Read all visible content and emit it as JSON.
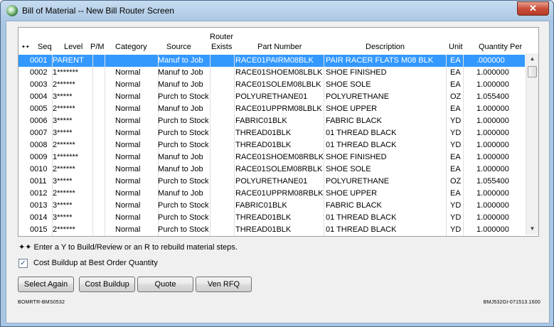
{
  "window": {
    "title": "Bill of Material -- New Bill Router Screen",
    "close_label": "✕"
  },
  "grid": {
    "headers": {
      "marker": "✦✦",
      "seq": "Seq",
      "level": "Level",
      "pm": "P/M",
      "category": "Category",
      "source": "Source",
      "router_line1": "Router",
      "router_line2": "Exists",
      "part": "Part Number",
      "description": "Description",
      "unit": "Unit",
      "qty": "Quantity Per"
    },
    "rows": [
      {
        "seq": "0001",
        "level": "PARENT",
        "pm": "",
        "category": "",
        "source": "Manuf to Job",
        "router": "",
        "part": "RACE01PAIRM08BLK",
        "description": "PAIR RACER FLATS M08 BLK",
        "unit": "EA",
        "qty": ".000000"
      },
      {
        "seq": "0002",
        "level": "1*******",
        "pm": "",
        "category": "Normal",
        "source": "Manuf to Job",
        "router": "",
        "part": "RACE01SHOEM08LBLK",
        "description": "SHOE FINISHED",
        "unit": "EA",
        "qty": "1.000000"
      },
      {
        "seq": "0003",
        "level": "2******",
        "pm": "",
        "category": "Normal",
        "source": "Manuf to Job",
        "router": "",
        "part": "RACE01SOLEM08LBLK",
        "description": "SHOE SOLE",
        "unit": "EA",
        "qty": "1.000000"
      },
      {
        "seq": "0004",
        "level": "3*****",
        "pm": "",
        "category": "Normal",
        "source": "Purch to Stock",
        "router": "",
        "part": "POLYURETHANE01",
        "description": "POLYURETHANE",
        "unit": "OZ",
        "qty": "1.055400"
      },
      {
        "seq": "0005",
        "level": "2******",
        "pm": "",
        "category": "Normal",
        "source": "Manuf to Job",
        "router": "",
        "part": "RACE01UPPRM08LBLK",
        "description": "SHOE UPPER",
        "unit": "EA",
        "qty": "1.000000"
      },
      {
        "seq": "0006",
        "level": "3*****",
        "pm": "",
        "category": "Normal",
        "source": "Purch to Stock",
        "router": "",
        "part": "FABRIC01BLK",
        "description": "FABRIC BLACK",
        "unit": "YD",
        "qty": "1.000000"
      },
      {
        "seq": "0007",
        "level": "3*****",
        "pm": "",
        "category": "Normal",
        "source": "Purch to Stock",
        "router": "",
        "part": "THREAD01BLK",
        "description": "01 THREAD BLACK",
        "unit": "YD",
        "qty": "1.000000"
      },
      {
        "seq": "0008",
        "level": "2******",
        "pm": "",
        "category": "Normal",
        "source": "Purch to Stock",
        "router": "",
        "part": "THREAD01BLK",
        "description": "01 THREAD BLACK",
        "unit": "YD",
        "qty": "1.000000"
      },
      {
        "seq": "0009",
        "level": "1*******",
        "pm": "",
        "category": "Normal",
        "source": "Manuf to Job",
        "router": "",
        "part": "RACE01SHOEM08RBLK",
        "description": "SHOE FINISHED",
        "unit": "EA",
        "qty": "1.000000"
      },
      {
        "seq": "0010",
        "level": "2******",
        "pm": "",
        "category": "Normal",
        "source": "Manuf to Job",
        "router": "",
        "part": "RACE01SOLEM08RBLK",
        "description": "SHOE SOLE",
        "unit": "EA",
        "qty": "1.000000"
      },
      {
        "seq": "0011",
        "level": "3*****",
        "pm": "",
        "category": "Normal",
        "source": "Purch to Stock",
        "router": "",
        "part": "POLYURETHANE01",
        "description": "POLYURETHANE",
        "unit": "OZ",
        "qty": "1.055400"
      },
      {
        "seq": "0012",
        "level": "2******",
        "pm": "",
        "category": "Normal",
        "source": "Manuf to Job",
        "router": "",
        "part": "RACE01UPPRM08RBLK",
        "description": "SHOE UPPER",
        "unit": "EA",
        "qty": "1.000000"
      },
      {
        "seq": "0013",
        "level": "3*****",
        "pm": "",
        "category": "Normal",
        "source": "Purch to Stock",
        "router": "",
        "part": "FABRIC01BLK",
        "description": "FABRIC BLACK",
        "unit": "YD",
        "qty": "1.000000"
      },
      {
        "seq": "0014",
        "level": "3*****",
        "pm": "",
        "category": "Normal",
        "source": "Purch to Stock",
        "router": "",
        "part": "THREAD01BLK",
        "description": "01 THREAD BLACK",
        "unit": "YD",
        "qty": "1.000000"
      },
      {
        "seq": "0015",
        "level": "2******",
        "pm": "",
        "category": "Normal",
        "source": "Purch to Stock",
        "router": "",
        "part": "THREAD01BLK",
        "description": "01 THREAD BLACK",
        "unit": "YD",
        "qty": "1.000000"
      }
    ]
  },
  "hint": "✦✦  Enter a Y to Build/Review or an R to rebuild material steps.",
  "checkbox": {
    "label": "Cost Buildup at Best Order Quantity",
    "checked": true,
    "mark": "✓"
  },
  "buttons": {
    "select_again": "Select Again",
    "cost_buildup": "Cost Buildup",
    "quote": "Quote",
    "ven_rfq": "Ven RFQ"
  },
  "footer": {
    "left": "BOMRTR-BMS0532",
    "right": "BMJ532GI-071513.1600"
  },
  "scroll": {
    "up": "▲",
    "down": "▼"
  }
}
